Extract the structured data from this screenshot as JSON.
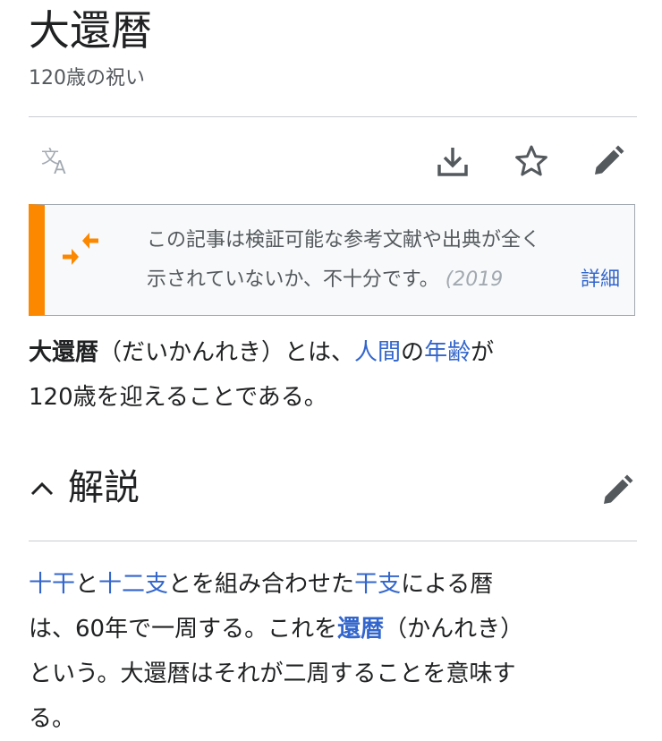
{
  "article": {
    "title": "大還暦",
    "subtitle": "120歳の祝い"
  },
  "toolbar": {
    "icons": [
      "language-icon",
      "download-icon",
      "star-icon",
      "edit-icon"
    ]
  },
  "notice": {
    "line1": "この記事は検証可能な参考文献や出典が全く",
    "line2_text": "示されていないか、不十分です。",
    "line2_date": "(2019",
    "more_label": "詳細",
    "accent_color": "#fc8800"
  },
  "lead": {
    "term": "大還暦",
    "reading": "（だいかんれき）とは、",
    "link_human": "人間",
    "particle_no": "の",
    "link_age": "年齢",
    "particle_ga": "が",
    "line2": "120歳を迎えることである。"
  },
  "section": {
    "title": "解説"
  },
  "body": {
    "link_jikkan": "十干",
    "text_to": "と",
    "link_junishi": "十二支",
    "text_combine": "とを組み合わせた",
    "link_eto": "干支",
    "text_reki": "による暦",
    "line2_text": "は、60年で一周する。これを",
    "link_kanreki": "還暦",
    "line2_reading": "（かんれき）",
    "line3": "という。大還暦はそれが二周することを意味す",
    "line4": "る。"
  },
  "colors": {
    "link": "#3366cc",
    "text": "#202122",
    "muted": "#54595d",
    "divider": "#c8ccd1"
  }
}
